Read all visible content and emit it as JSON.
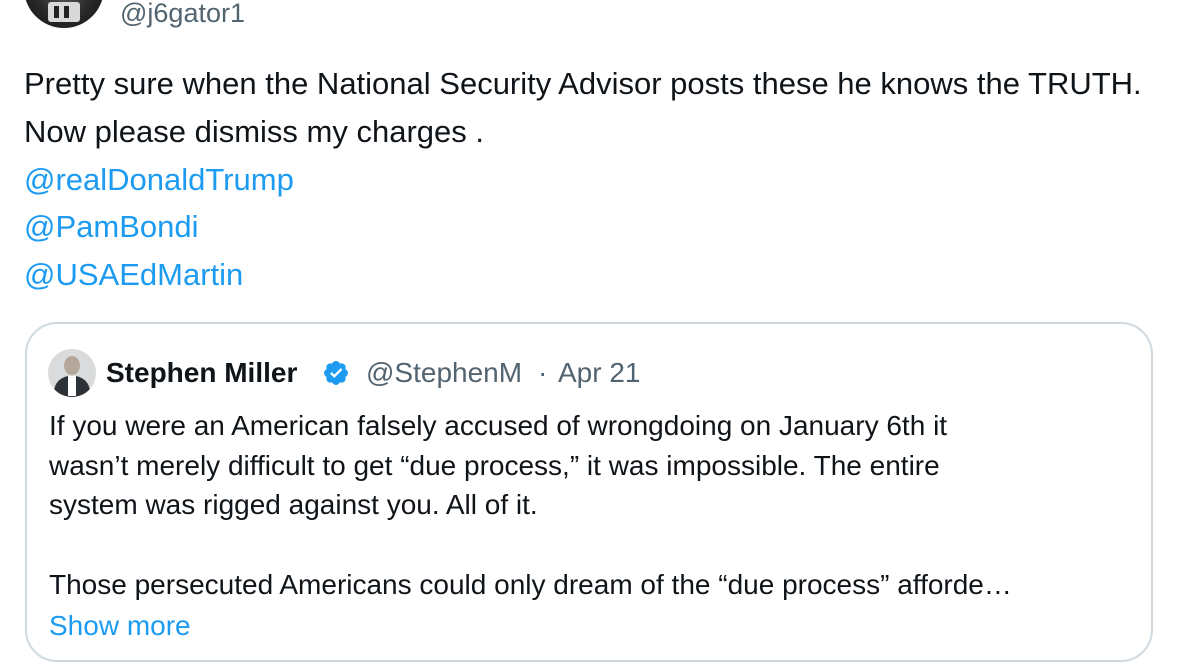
{
  "post": {
    "handle": "@j6gator1",
    "text": "Pretty sure when the National Security Advisor posts these he knows the TRUTH. Now please dismiss my charges .",
    "mentions": [
      "@realDonaldTrump",
      "@PamBondi",
      "@USAEdMartin"
    ]
  },
  "quoted_post": {
    "author_name": "Stephen Miller",
    "verified": true,
    "handle": "@StephenM",
    "separator": "·",
    "date": "Apr 21",
    "lines": [
      "If you were an American falsely accused of wrongdoing on January 6th it",
      "wasn’t merely difficult to get “due process,” it was impossible. The entire",
      "system was rigged against you. All of it.",
      "Those persecuted Americans could only dream of the “due process” affordе…"
    ],
    "show_more_label": "Show more"
  },
  "icons": {
    "verified_badge": "verified-badge-icon",
    "verified_color": "#1d9bf0"
  },
  "colors": {
    "link": "#1d9bf0",
    "secondary_text": "#536471",
    "border": "#cfd9de"
  }
}
